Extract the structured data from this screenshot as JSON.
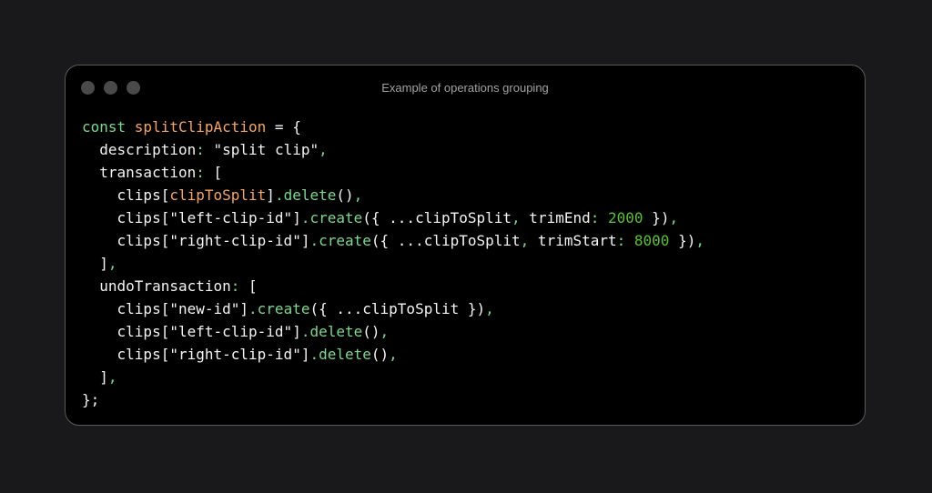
{
  "window": {
    "title": "Example of operations grouping"
  },
  "code": {
    "lines": [
      [
        {
          "t": "const ",
          "c": "keyword"
        },
        {
          "t": "splitClipAction",
          "c": "def"
        },
        {
          "t": " = {",
          "c": "text"
        }
      ],
      [
        {
          "t": "  description",
          "c": "text"
        },
        {
          "t": ":",
          "c": "accent"
        },
        {
          "t": " \"split clip\"",
          "c": "string"
        },
        {
          "t": ",",
          "c": "accent"
        }
      ],
      [
        {
          "t": "  transaction",
          "c": "text"
        },
        {
          "t": ":",
          "c": "accent"
        },
        {
          "t": " [",
          "c": "text"
        }
      ],
      [
        {
          "t": "    clips[",
          "c": "text"
        },
        {
          "t": "clipToSplit",
          "c": "def"
        },
        {
          "t": "]",
          "c": "text"
        },
        {
          "t": ".delete",
          "c": "accent"
        },
        {
          "t": "()",
          "c": "text"
        },
        {
          "t": ",",
          "c": "accent"
        }
      ],
      [
        {
          "t": "    clips[\"left-clip-id\"]",
          "c": "text"
        },
        {
          "t": ".create",
          "c": "accent"
        },
        {
          "t": "({ ...clipToSplit",
          "c": "text"
        },
        {
          "t": ",",
          "c": "accent"
        },
        {
          "t": " trimEnd",
          "c": "text"
        },
        {
          "t": ":",
          "c": "accent"
        },
        {
          "t": " ",
          "c": "text"
        },
        {
          "t": "2000",
          "c": "number"
        },
        {
          "t": " })",
          "c": "text"
        },
        {
          "t": ",",
          "c": "accent"
        }
      ],
      [
        {
          "t": "    clips[\"right-clip-id\"]",
          "c": "text"
        },
        {
          "t": ".create",
          "c": "accent"
        },
        {
          "t": "({ ...clipToSplit",
          "c": "text"
        },
        {
          "t": ",",
          "c": "accent"
        },
        {
          "t": " trimStart",
          "c": "text"
        },
        {
          "t": ":",
          "c": "accent"
        },
        {
          "t": " ",
          "c": "text"
        },
        {
          "t": "8000",
          "c": "number"
        },
        {
          "t": " })",
          "c": "text"
        },
        {
          "t": ",",
          "c": "accent"
        }
      ],
      [
        {
          "t": "  ]",
          "c": "text"
        },
        {
          "t": ",",
          "c": "accent"
        }
      ],
      [
        {
          "t": "  undoTransaction",
          "c": "text"
        },
        {
          "t": ":",
          "c": "accent"
        },
        {
          "t": " [",
          "c": "text"
        }
      ],
      [
        {
          "t": "    clips[\"new-id\"]",
          "c": "text"
        },
        {
          "t": ".create",
          "c": "accent"
        },
        {
          "t": "({ ...clipToSplit })",
          "c": "text"
        },
        {
          "t": ",",
          "c": "accent"
        }
      ],
      [
        {
          "t": "    clips[\"left-clip-id\"]",
          "c": "text"
        },
        {
          "t": ".delete",
          "c": "accent"
        },
        {
          "t": "()",
          "c": "text"
        },
        {
          "t": ",",
          "c": "accent"
        }
      ],
      [
        {
          "t": "    clips[\"right-clip-id\"]",
          "c": "text"
        },
        {
          "t": ".delete",
          "c": "accent"
        },
        {
          "t": "()",
          "c": "text"
        },
        {
          "t": ",",
          "c": "accent"
        }
      ],
      [
        {
          "t": "  ]",
          "c": "text"
        },
        {
          "t": ",",
          "c": "accent"
        }
      ],
      [
        {
          "t": "};",
          "c": "text"
        }
      ]
    ]
  },
  "colors": {
    "page_background": "#19191b",
    "window_background": "#000000",
    "window_border": "#5a5a5e",
    "traffic_dot": "#4a4a4d",
    "title_text": "#a2a2a6",
    "code_text": "#f4f4f4",
    "keyword": "#7bd88f",
    "identifier": "#f6a564",
    "number": "#59c232"
  },
  "icons": [
    "window-control-dot-icon"
  ]
}
